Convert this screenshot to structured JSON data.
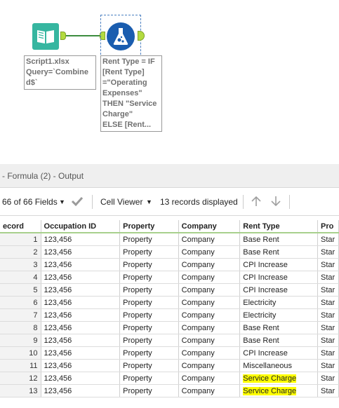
{
  "canvas": {
    "input_annotation": "Script1.xlsx\nQuery=`Combine\nd$`",
    "formula_annotation": "Rent Type = IF\n[Rent Type]\n=\"Operating\nExpenses\"\nTHEN \"Service\nCharge\"\nELSE [Rent..."
  },
  "results": {
    "pane_title": "- Formula (2) - Output",
    "toolbar": {
      "fields_label": "66 of 66 Fields",
      "viewer_label": "Cell Viewer",
      "records_label": "13 records displayed"
    },
    "columns": [
      "ecord",
      "Occupation ID",
      "Property",
      "Company",
      "Rent Type",
      "Pro"
    ],
    "rows": [
      {
        "record": "1",
        "occupation_id": "123,456",
        "property": "Property",
        "company": "Company",
        "rent_type": "Base Rent",
        "pro": "Star"
      },
      {
        "record": "2",
        "occupation_id": "123,456",
        "property": "Property",
        "company": "Company",
        "rent_type": "Base Rent",
        "pro": "Star"
      },
      {
        "record": "3",
        "occupation_id": "123,456",
        "property": "Property",
        "company": "Company",
        "rent_type": "CPI Increase",
        "pro": "Star"
      },
      {
        "record": "4",
        "occupation_id": "123,456",
        "property": "Property",
        "company": "Company",
        "rent_type": "CPI Increase",
        "pro": "Star"
      },
      {
        "record": "5",
        "occupation_id": "123,456",
        "property": "Property",
        "company": "Company",
        "rent_type": "CPI Increase",
        "pro": "Star"
      },
      {
        "record": "6",
        "occupation_id": "123,456",
        "property": "Property",
        "company": "Company",
        "rent_type": "Electricity",
        "pro": "Star"
      },
      {
        "record": "7",
        "occupation_id": "123,456",
        "property": "Property",
        "company": "Company",
        "rent_type": "Electricity",
        "pro": "Star"
      },
      {
        "record": "8",
        "occupation_id": "123,456",
        "property": "Property",
        "company": "Company",
        "rent_type": "Base Rent",
        "pro": "Star"
      },
      {
        "record": "9",
        "occupation_id": "123,456",
        "property": "Property",
        "company": "Company",
        "rent_type": "Base Rent",
        "pro": "Star"
      },
      {
        "record": "10",
        "occupation_id": "123,456",
        "property": "Property",
        "company": "Company",
        "rent_type": "CPI Increase",
        "pro": "Star"
      },
      {
        "record": "11",
        "occupation_id": "123,456",
        "property": "Property",
        "company": "Company",
        "rent_type": "Miscellaneous",
        "pro": "Star"
      },
      {
        "record": "12",
        "occupation_id": "123,456",
        "property": "Property",
        "company": "Company",
        "rent_type": "Service Charge",
        "pro": "Star",
        "highlight": true
      },
      {
        "record": "13",
        "occupation_id": "123,456",
        "property": "Property",
        "company": "Company",
        "rent_type": "Service Charge",
        "pro": "Star",
        "highlight": true
      }
    ]
  },
  "colors": {
    "input_tool": "#36b6a0",
    "formula_tool": "#1a5daf",
    "highlight": "#ffff00",
    "header_underline": "#a8d08d"
  },
  "icons": {
    "input_tool": "book-icon",
    "formula_tool": "flask-icon",
    "apply": "checkmark-icon",
    "prev": "arrow-up-icon",
    "next": "arrow-down-icon"
  }
}
